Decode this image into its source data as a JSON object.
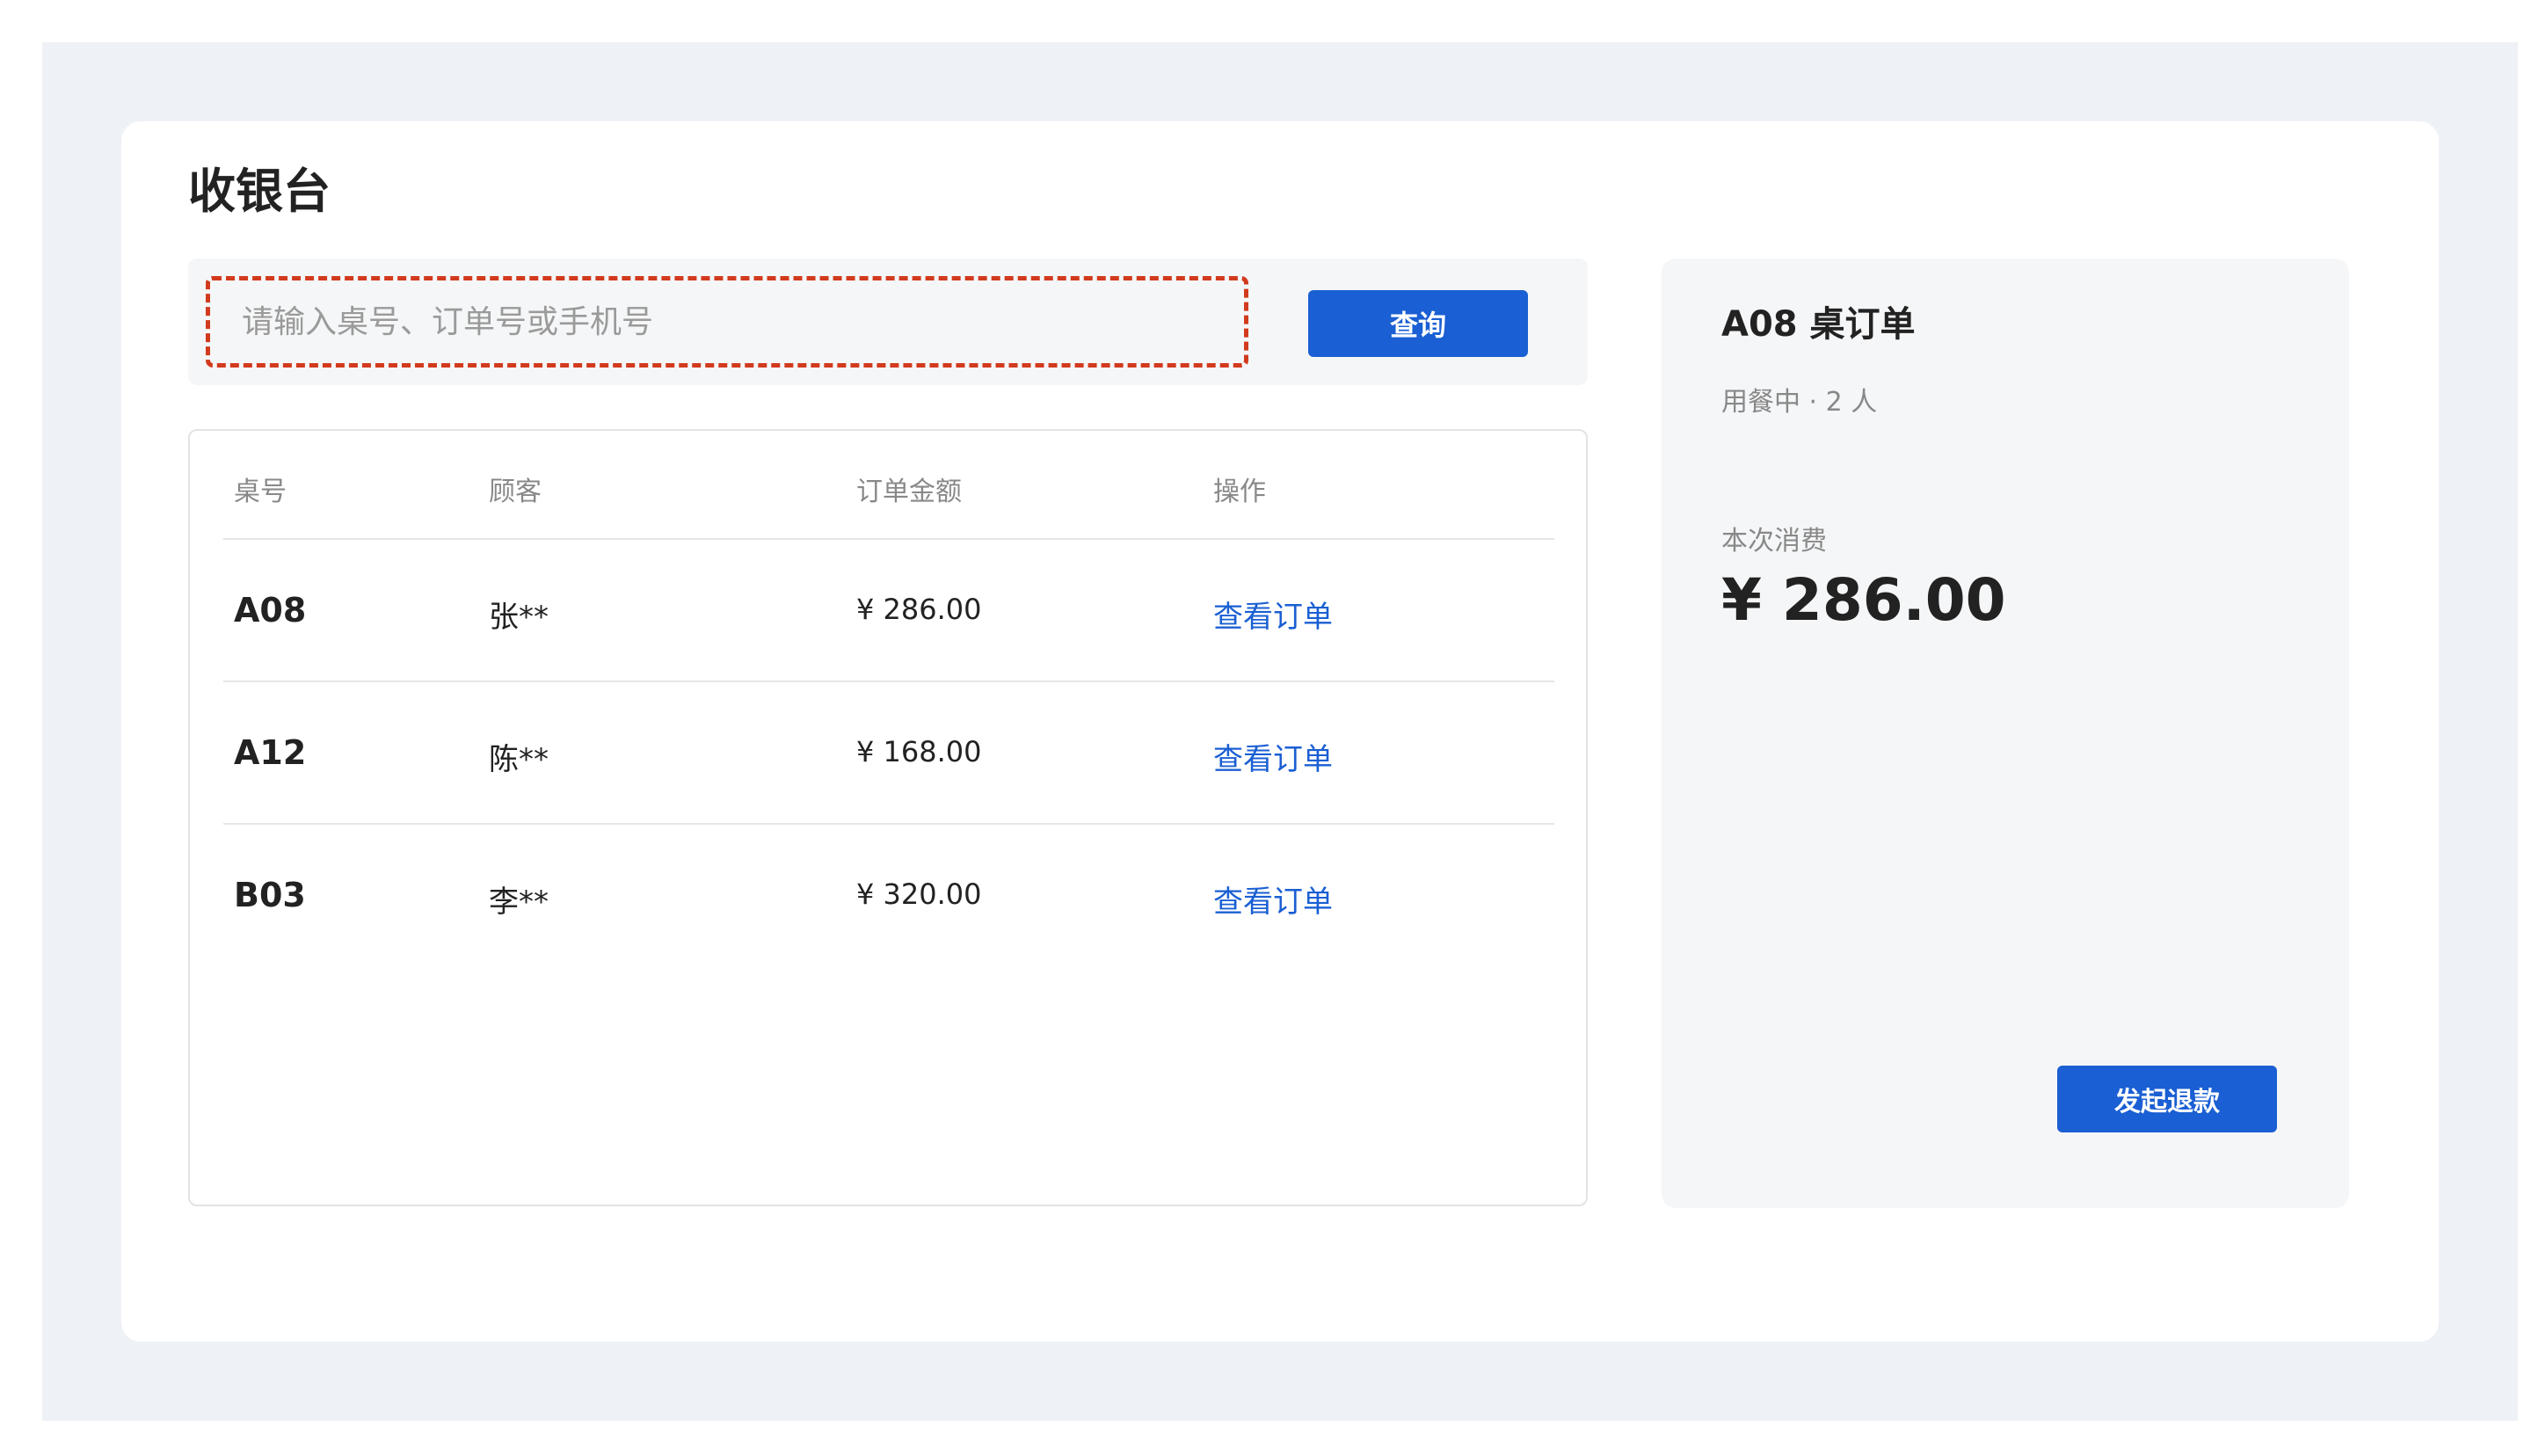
{
  "app": {
    "title": "收银台"
  },
  "search": {
    "placeholder": "请输入桌号、订单号或手机号",
    "button_label": "查询"
  },
  "table": {
    "headers": [
      "桌号",
      "顾客",
      "订单金额",
      "操作"
    ],
    "rows": [
      {
        "table_no": "A08",
        "customer": "张**",
        "amount": "¥ 286.00",
        "action": "查看订单"
      },
      {
        "table_no": "A12",
        "customer": "陈**",
        "amount": "¥ 168.00",
        "action": "查看订单"
      },
      {
        "table_no": "B03",
        "customer": "李**",
        "amount": "¥ 320.00",
        "action": "查看订单"
      }
    ]
  },
  "order_panel": {
    "title": "A08 桌订单",
    "status": "用餐中 · 2 人",
    "consume_label": "本次消费",
    "consume_amount": "¥ 286.00",
    "refund_button_label": "发起退款"
  },
  "colors": {
    "accent": "#1a5fd3",
    "highlight_border": "#d23a1e",
    "frame_background": "#eef1f5",
    "panel_background": "#f5f6f7"
  }
}
